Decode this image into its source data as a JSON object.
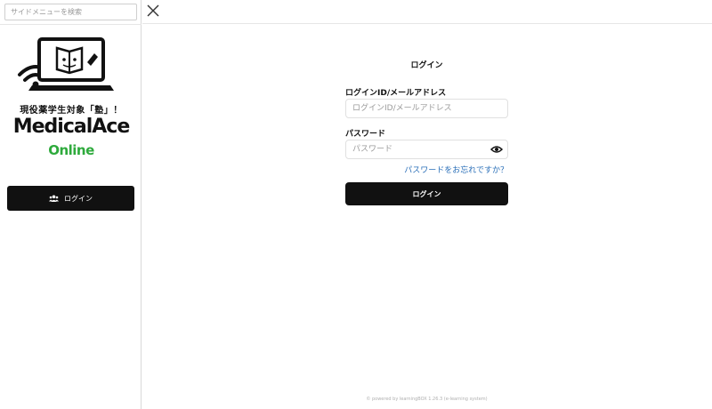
{
  "sidebar": {
    "search_placeholder": "サイドメニューを検索",
    "logo": {
      "tagline": "現役薬学生対象「塾」！",
      "brand": "MedicalAce",
      "brand_sub": "Online"
    },
    "login_button": {
      "label": "ログイン",
      "icon": "users-icon"
    }
  },
  "topbar": {
    "close_icon": "close-icon"
  },
  "main": {
    "title": "ログイン",
    "login_id": {
      "label": "ログインID/メールアドレス",
      "placeholder": "ログインID/メールアドレス"
    },
    "password": {
      "label": "パスワード",
      "placeholder": "パスワード",
      "toggle_icon": "eye-icon"
    },
    "forgot_link": "パスワードをお忘れですか？",
    "login_button": "ログイン",
    "footer": "© powered by learningBOX 1.26.3 (e-learning system)"
  },
  "colors": {
    "button_bg": "#111111",
    "link": "#2a6fb8",
    "brand_green": "#2eaa3c"
  }
}
